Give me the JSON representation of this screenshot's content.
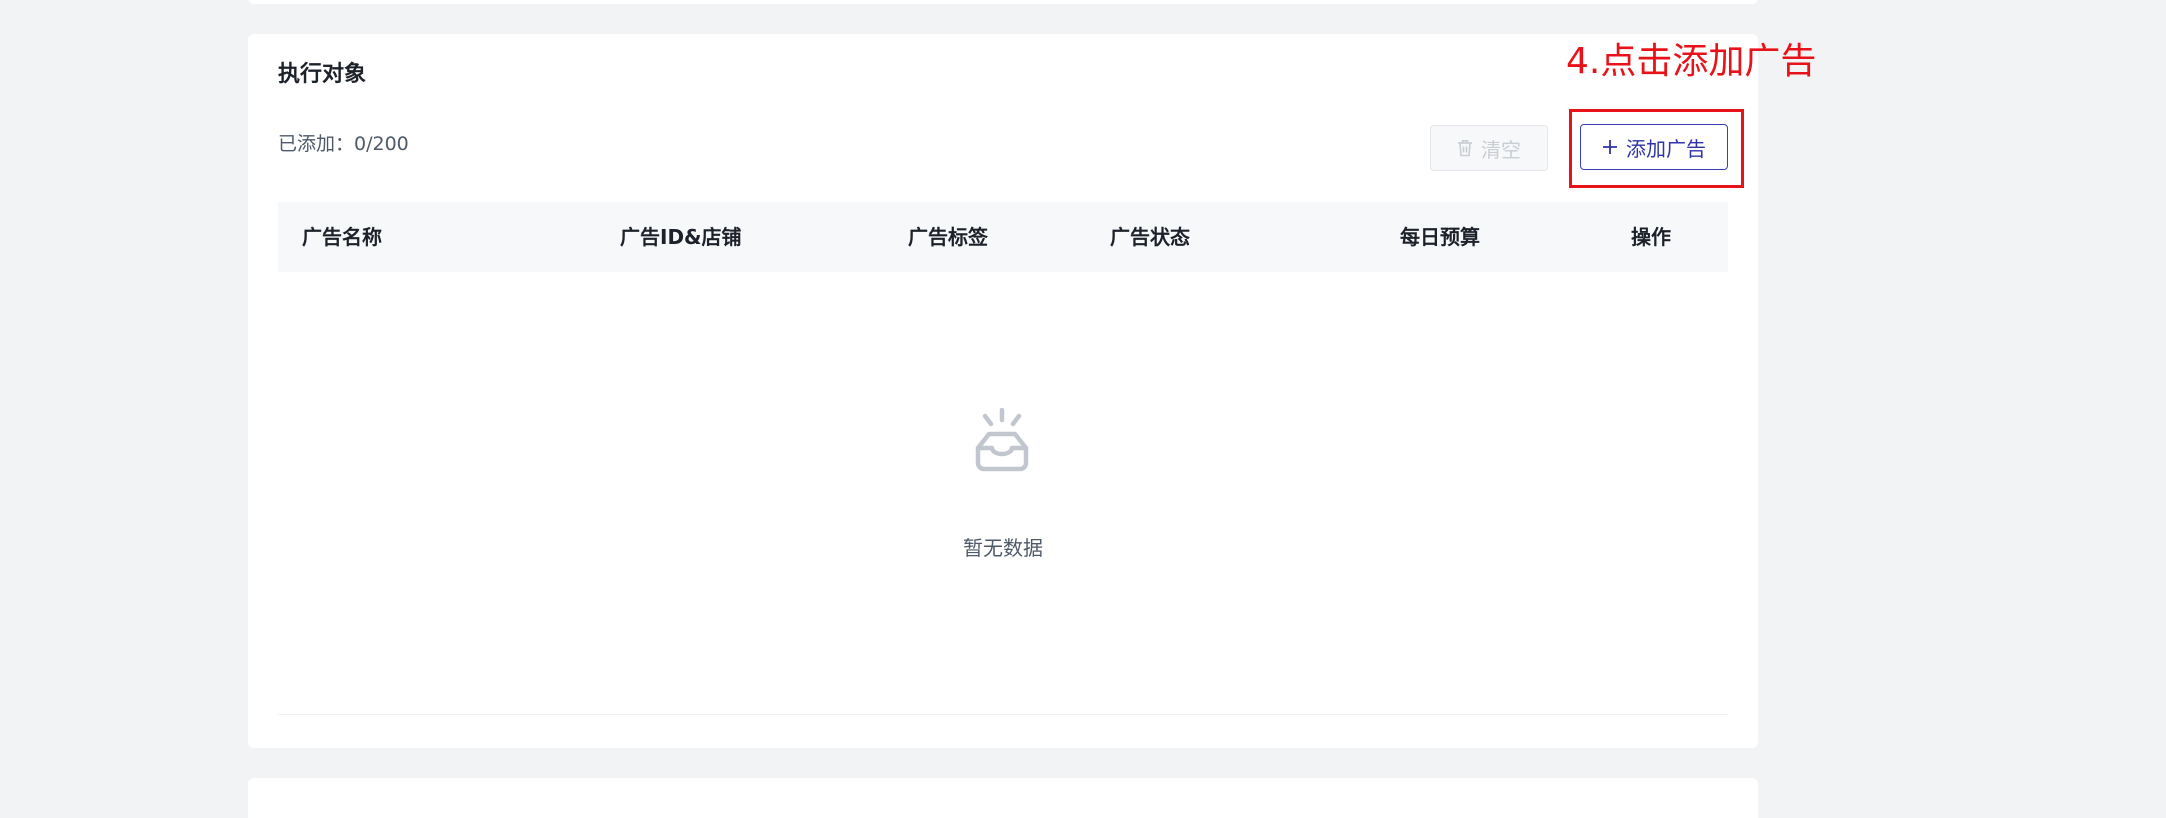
{
  "section": {
    "title": "执行对象",
    "added_count": "已添加：0/200"
  },
  "toolbar": {
    "clear_label": "清空",
    "clear_icon": "trash-icon",
    "add_label": "添加广告",
    "add_icon": "plus-icon"
  },
  "annotation": {
    "text": "4.点击添加广告",
    "color": "#e8131a"
  },
  "table": {
    "columns": [
      "广告名称",
      "广告ID&店铺",
      "广告标签",
      "广告状态",
      "每日预算",
      "操作"
    ],
    "rows": []
  },
  "empty_state": {
    "icon": "empty-inbox-icon",
    "text": "暂无数据"
  },
  "colors": {
    "accent": "#2f33a8",
    "annotation_red": "#e8131a",
    "page_background": "#f2f3f5"
  }
}
